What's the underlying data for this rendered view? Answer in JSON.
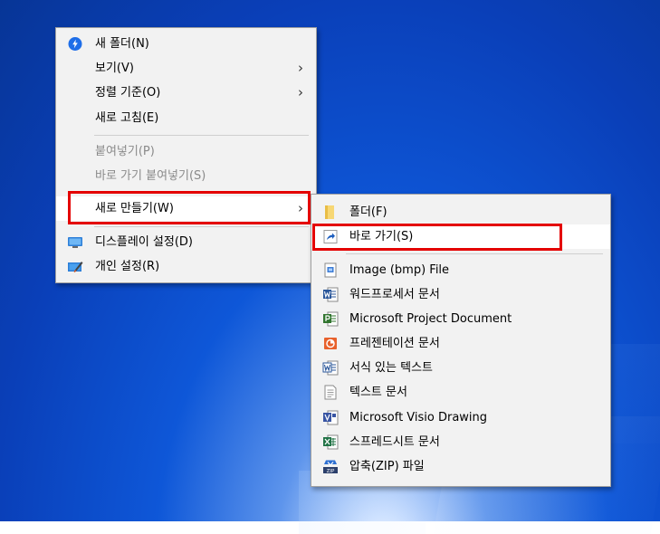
{
  "context_menu": {
    "items": [
      {
        "label": "새 폴더(N)",
        "icon": "new-folder-icon",
        "enabled": true
      },
      {
        "label": "보기(V)",
        "has_submenu": true,
        "enabled": true
      },
      {
        "label": "정렬 기준(O)",
        "has_submenu": true,
        "enabled": true
      },
      {
        "label": "새로 고침(E)",
        "enabled": true
      },
      {
        "label": "붙여넣기(P)",
        "enabled": false
      },
      {
        "label": "바로 가기 붙여넣기(S)",
        "enabled": false
      },
      {
        "label": "새로 만들기(W)",
        "has_submenu": true,
        "enabled": true,
        "highlighted": true
      },
      {
        "label": "디스플레이 설정(D)",
        "icon": "display-settings-icon",
        "enabled": true
      },
      {
        "label": "개인 설정(R)",
        "icon": "personalize-icon",
        "enabled": true
      }
    ],
    "submenu_arrow": "›"
  },
  "new_submenu": {
    "items": [
      {
        "label": "폴더(F)",
        "icon": "folder-icon"
      },
      {
        "label": "바로 가기(S)",
        "icon": "shortcut-icon"
      },
      {
        "label": "Image (bmp) File",
        "icon": "bmp-file-icon"
      },
      {
        "label": "워드프로세서 문서",
        "icon": "word-document-icon"
      },
      {
        "label": "Microsoft Project Document",
        "icon": "project-document-icon"
      },
      {
        "label": "프레젠테이션 문서",
        "icon": "powerpoint-document-icon"
      },
      {
        "label": "서식 있는 텍스트",
        "icon": "rich-text-icon"
      },
      {
        "label": "텍스트 문서",
        "icon": "text-document-icon"
      },
      {
        "label": "Microsoft Visio Drawing",
        "icon": "visio-drawing-icon"
      },
      {
        "label": "스프레드시트 문서",
        "icon": "excel-spreadsheet-icon"
      },
      {
        "label": "압축(ZIP) 파일",
        "icon": "zip-file-icon"
      }
    ]
  },
  "colors": {
    "menu_background": "#f2f2f2",
    "highlight_background": "#ffffff",
    "annotation_red": "#e40000",
    "disabled_text": "#8a8a8a"
  }
}
